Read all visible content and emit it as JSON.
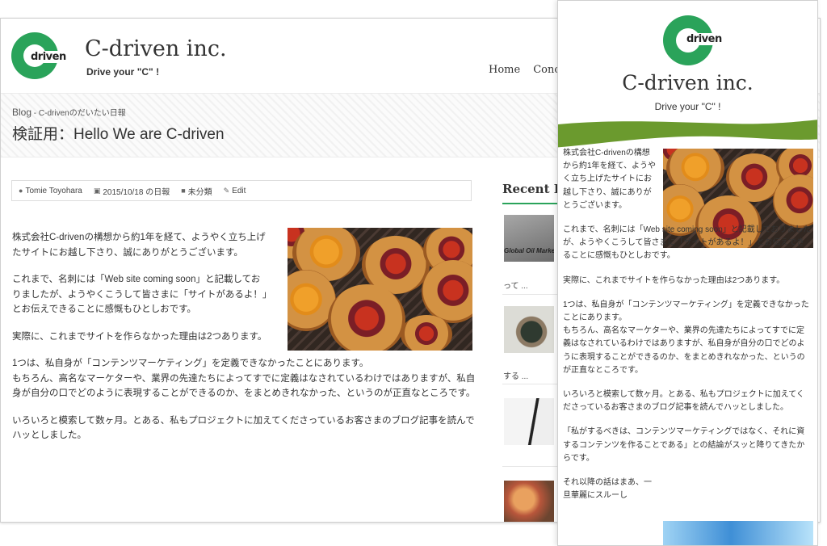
{
  "site": {
    "name": "C-driven inc.",
    "tagline": "Drive your \"C\" !",
    "logo_text": "driven",
    "accent_color": "#2aa35a",
    "wave_color": "#6b9a2e"
  },
  "desktop": {
    "nav": [
      "Home",
      "Conc"
    ],
    "breadcrumb": {
      "blog": "Blog",
      "sep": " - ",
      "section": "C-drivenのだいたい日報"
    },
    "page_title": "検証用：Hello We are C-driven",
    "meta": {
      "author": "Tomie Toyohara",
      "date": "2015/10/18 の日報",
      "category": "未分類",
      "edit": "Edit"
    },
    "paragraphs": [
      "株式会社C-drivenの構想から約1年を経て、ようやく立ち上げたサイトにお越し下さり、誠にありがとうございます。",
      "これまで、名刺には「Web site coming soon」と記載しておりましたが、ようやくこうして皆さまに「サイトがあるよ！」とお伝えできることに感慨もひとしおです。",
      "実際に、これまでサイトを作らなかった理由は2つあります。",
      "1つは、私自身が「コンテンツマーケティング」を定義できなかったことにあります。\nもちろん、高名なマーケターや、業界の先達たちによってすでに定義はなされているわけではありますが、私自身が自分の口でどのように表現することができるのか、をまとめきれなかった、というのが正直なところです。",
      "いろいろと模索して数ヶ月。とある、私もプロジェクトに加えてくださっているお客さまのブログ記事を読んでハッとしました。"
    ],
    "sidebar": {
      "title": "Recent P",
      "items": [
        {
          "thumb_text": "Global Oil Marke",
          "text": "って ..."
        },
        {
          "text": "する ..."
        },
        {
          "text": ""
        },
        {
          "text": ""
        }
      ]
    }
  },
  "mobile": {
    "paragraphs": [
      "株式会社C-drivenの構想から約1年を経て、ようやく立ち上げたサイトにお越し下さり、誠にありがとうございます。",
      "これまで、名刺には「Web site coming soon」と記載しておりましたが、ようやくこうして皆さまに「サイトがあるよ！」とお伝えできることに感慨もひとしおです。",
      "実際に、これまでサイトを作らなかった理由は2つあります。",
      "1つは、私自身が「コンテンツマーケティング」を定義できなかったことにあります。\nもちろん、高名なマーケターや、業界の先達たちによってすでに定義はなされているわけではありますが、私自身が自分の口でどのように表現することができるのか、をまとめきれなかった、というのが正直なところです。",
      "いろいろと模索して数ヶ月。とある、私もプロジェクトに加えてくださっているお客さまのブログ記事を読んでハッとしました。",
      "「私がするべきは、コンテンツマーケティングではなく、それに資するコンテンツを作ることである」との結論がスッと降りてきたからです。",
      "それ以降の話はまあ、一旦華麗にスルーし"
    ]
  }
}
